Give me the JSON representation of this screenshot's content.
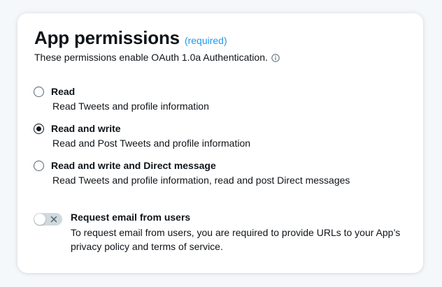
{
  "section": {
    "title": "App permissions",
    "required_label": "(required)",
    "subtitle": "These permissions enable OAuth 1.0a Authentication.",
    "info_icon": "info-icon"
  },
  "permissions": {
    "selected": "Read and write",
    "options": [
      {
        "label": "Read",
        "description": "Read Tweets and profile information",
        "checked": false
      },
      {
        "label": "Read and write",
        "description": "Read and Post Tweets and profile information",
        "checked": true
      },
      {
        "label": "Read and write and Direct message",
        "description": "Read Tweets and profile information, read and post Direct messages",
        "checked": false
      }
    ]
  },
  "email_toggle": {
    "label": "Request email from users",
    "description": "To request email from users, you are required to provide URLs to your App’s privacy policy and terms of service.",
    "enabled": false,
    "icon": "close-icon"
  },
  "colors": {
    "accent": "#1d9bf0",
    "text": "#0f1419",
    "toggle_off": "#cfd9de"
  }
}
